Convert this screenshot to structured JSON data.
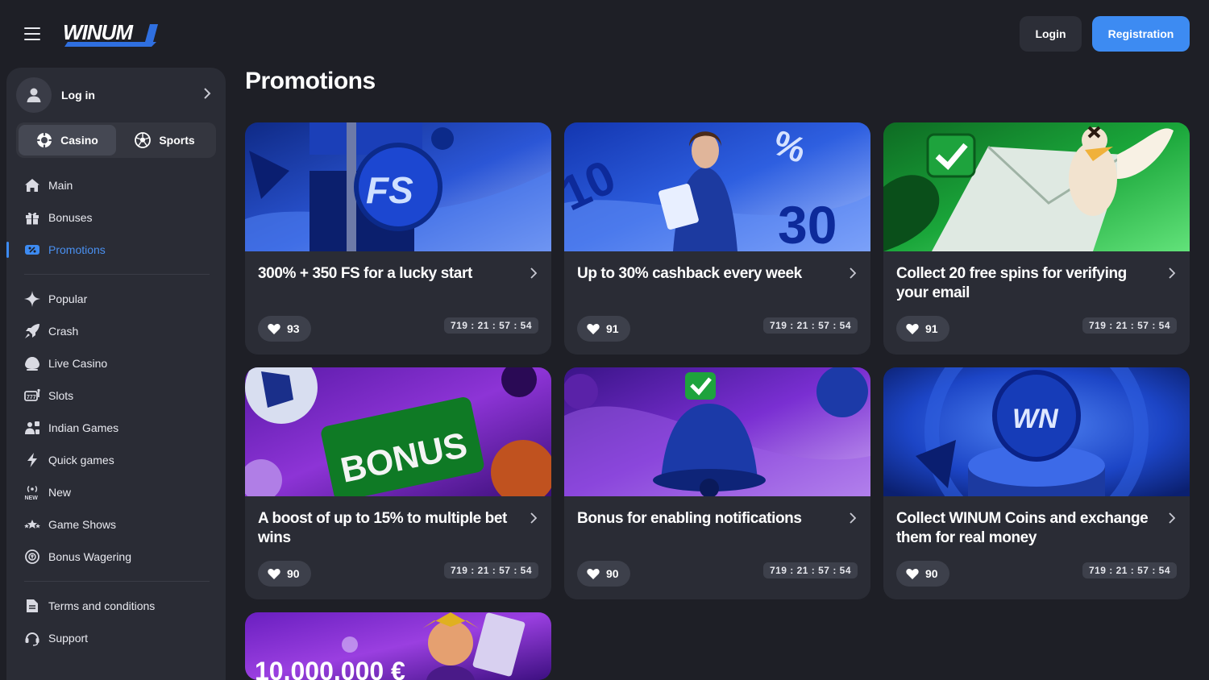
{
  "header": {
    "logo_text": "WINUM",
    "login_label": "Login",
    "registration_label": "Registration"
  },
  "sidebar": {
    "user_label": "Log in",
    "modes": [
      {
        "label": "Casino",
        "active": true
      },
      {
        "label": "Sports",
        "active": false
      }
    ],
    "nav_primary": [
      {
        "label": "Main",
        "icon": "home-icon"
      },
      {
        "label": "Bonuses",
        "icon": "gift-icon"
      },
      {
        "label": "Promotions",
        "icon": "promo-icon",
        "active": true
      }
    ],
    "nav_games": [
      {
        "label": "Popular",
        "icon": "sparkle-icon"
      },
      {
        "label": "Crash",
        "icon": "rocket-icon"
      },
      {
        "label": "Live Casino",
        "icon": "live-casino-icon"
      },
      {
        "label": "Slots",
        "icon": "slots-icon"
      },
      {
        "label": "Indian Games",
        "icon": "indian-games-icon"
      },
      {
        "label": "Quick games",
        "icon": "lightning-icon"
      },
      {
        "label": "New",
        "icon": "new-icon"
      },
      {
        "label": "Game Shows",
        "icon": "game-shows-icon"
      },
      {
        "label": "Bonus Wagering",
        "icon": "wagering-icon"
      }
    ],
    "nav_footer": [
      {
        "label": "Terms and conditions",
        "icon": "document-icon"
      },
      {
        "label": "Support",
        "icon": "headset-icon"
      }
    ]
  },
  "main": {
    "title": "Promotions",
    "cards": [
      {
        "title": "300% + 350 FS for a lucky start",
        "likes": "93",
        "timer": "719 : 21 : 57 : 54",
        "banner_text": "FS"
      },
      {
        "title": "Up to 30% cashback every week",
        "likes": "91",
        "timer": "719 : 21 : 57 : 54",
        "banner_text": "30"
      },
      {
        "title": "Collect 20 free spins for verifying your email",
        "likes": "91",
        "timer": "719 : 21 : 57 : 54",
        "banner_text": ""
      },
      {
        "title": "A boost of up to 15% to multiple bet wins",
        "likes": "90",
        "timer": "719 : 21 : 57 : 54",
        "banner_text": "BONUS"
      },
      {
        "title": "Bonus for enabling notifications",
        "likes": "90",
        "timer": "719 : 21 : 57 : 54",
        "banner_text": ""
      },
      {
        "title": "Collect WINUM Coins and exchange them for real money",
        "likes": "90",
        "timer": "719 : 21 : 57 : 54",
        "banner_text": "WN"
      },
      {
        "title": "",
        "likes": "",
        "timer": "",
        "banner_text": "10.000.000 €"
      }
    ]
  },
  "colors": {
    "background": "#1e1f26",
    "panel": "#2a2c35",
    "accent": "#3d8bf2",
    "active_nav": "#4a90f0"
  }
}
